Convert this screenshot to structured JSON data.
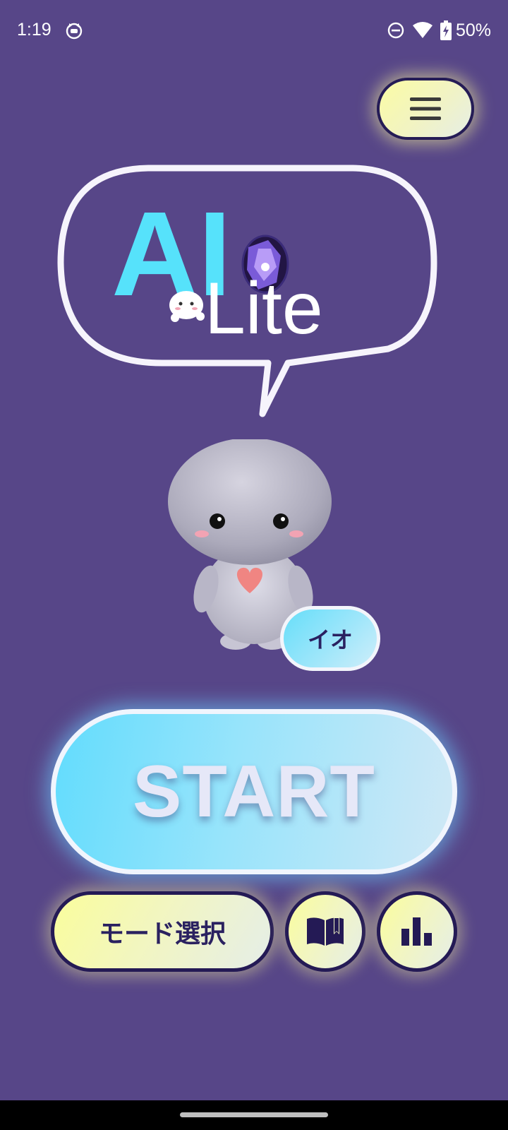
{
  "status_bar": {
    "time": "1:19",
    "battery": "50%",
    "icons": [
      "cat-app-icon",
      "do-not-disturb-icon",
      "wifi-icon",
      "battery-charging-icon"
    ]
  },
  "menu": {
    "icon": "hamburger-menu-icon"
  },
  "logo": {
    "text_main": "AI",
    "text_sub": "Lite"
  },
  "character": {
    "name": "イオ"
  },
  "actions": {
    "start_label": "START",
    "mode_label": "モード選択",
    "guide_icon": "book-icon",
    "stats_icon": "bar-chart-icon"
  },
  "colors": {
    "background": "#574688",
    "accent_cyan": "#62dcfd",
    "accent_yellow": "#fafd9c",
    "button_border": "#241a55"
  }
}
